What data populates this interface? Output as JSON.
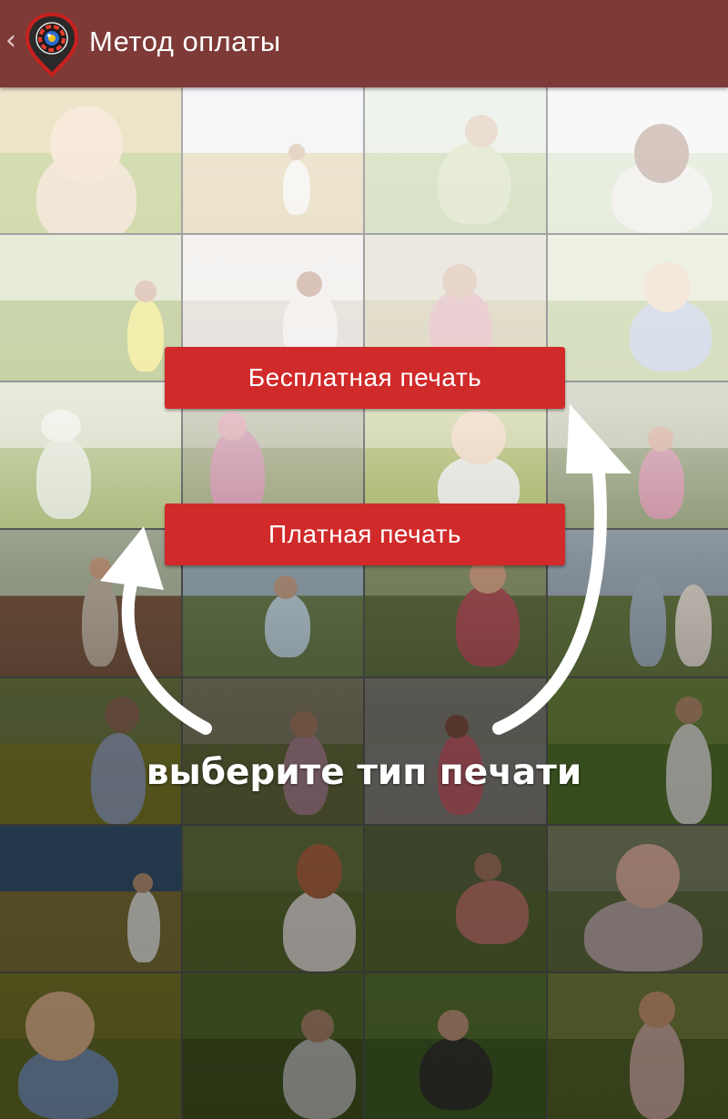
{
  "appbar": {
    "title": "Метод оплаты",
    "back_icon": "chevron-left-icon",
    "logo_icon": "camera-pin-logo-icon",
    "bg_color": "#7e3a37"
  },
  "actions": {
    "free_print_label": "Бесплатная печать",
    "paid_print_label": "Платная печать",
    "button_color": "#d12a2a"
  },
  "hint": {
    "text": "выберите тип печати"
  },
  "background": {
    "photo_grid_icon": "photo-collage",
    "rows": 7,
    "columns": 4
  }
}
